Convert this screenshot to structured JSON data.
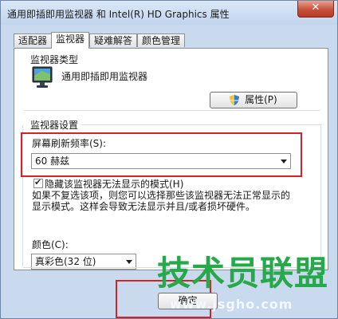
{
  "window": {
    "title": "通用即插即用监视器 和 Intel(R) HD Graphics 属性",
    "close_glyph": "✕"
  },
  "tabs": [
    {
      "label": "适配器"
    },
    {
      "label": "监视器"
    },
    {
      "label": "疑难解答"
    },
    {
      "label": "颜色管理"
    }
  ],
  "active_tab": "监视器",
  "monitor_type": {
    "heading": "监视器类型",
    "name": "通用即插即用监视器",
    "icon": "monitor-icon",
    "properties_button": "属性(P)"
  },
  "monitor_settings": {
    "heading": "监视器设置",
    "refresh_label": "屏幕刷新频率(S):",
    "refresh_value": "60 赫兹",
    "hide_modes_checked": true,
    "hide_modes_label": "隐藏该监视器无法显示的模式(H)",
    "description_line1": "如果不复选该项，则您可以选择那些该监视器无法正常显示的",
    "description_line2": "显示模式。这样会导致无法显示并且/或者损坏硬件。",
    "colors_label": "颜色(C):",
    "colors_value": "真彩色(32 位)"
  },
  "footer": {
    "ok_button": "确定"
  },
  "watermark": {
    "logo_text": "技术员联盟",
    "url": "www.jsgho.com"
  },
  "highlight_color": "#d2232a",
  "watermark_color": "#27a84a"
}
